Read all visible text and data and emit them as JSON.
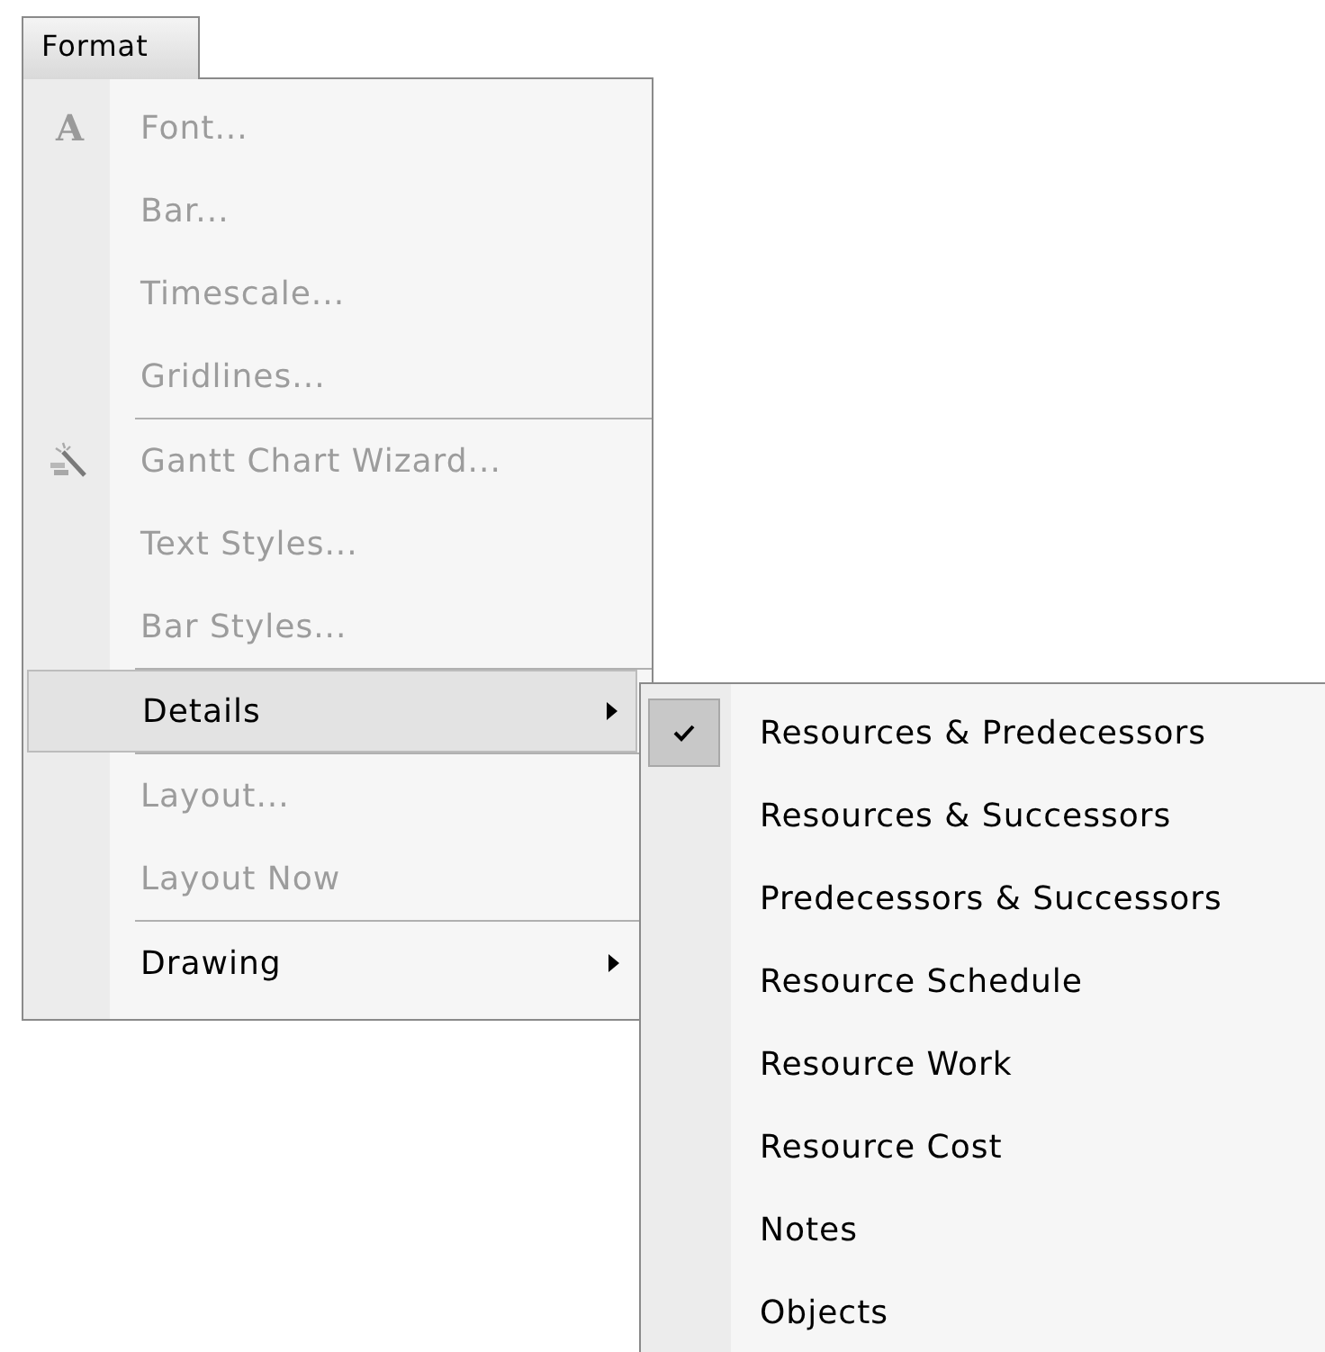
{
  "menu_title": "Format",
  "menu_items": [
    {
      "label": "Font...",
      "disabled": true,
      "selected": false,
      "submenu": false,
      "kind": "glyph",
      "icon_text": "A",
      "separator_before": false
    },
    {
      "label": "Bar...",
      "disabled": true,
      "selected": false,
      "submenu": false,
      "separator_before": false
    },
    {
      "label": "Timescale...",
      "disabled": true,
      "selected": false,
      "submenu": false,
      "separator_before": false
    },
    {
      "label": "Gridlines...",
      "disabled": true,
      "selected": false,
      "submenu": false,
      "separator_before": false
    },
    {
      "label": "Gantt Chart Wizard...",
      "disabled": true,
      "selected": false,
      "submenu": false,
      "kind": "wand",
      "separator_before": true
    },
    {
      "label": "Text Styles...",
      "disabled": true,
      "selected": false,
      "submenu": false,
      "separator_before": false
    },
    {
      "label": "Bar Styles...",
      "disabled": true,
      "selected": false,
      "submenu": false,
      "separator_before": false
    },
    {
      "label": "Details",
      "disabled": false,
      "selected": true,
      "submenu": true,
      "separator_before": true
    },
    {
      "label": "Layout...",
      "disabled": true,
      "selected": false,
      "submenu": false,
      "separator_before": true
    },
    {
      "label": "Layout Now",
      "disabled": true,
      "selected": false,
      "submenu": false,
      "separator_before": false
    },
    {
      "label": "Drawing",
      "disabled": false,
      "selected": false,
      "submenu": true,
      "separator_before": true
    }
  ],
  "submenu_items": [
    {
      "label": "Resources & Predecessors",
      "checked": true
    },
    {
      "label": "Resources & Successors",
      "checked": false
    },
    {
      "label": "Predecessors & Successors",
      "checked": false
    },
    {
      "label": "Resource Schedule",
      "checked": false
    },
    {
      "label": "Resource Work",
      "checked": false
    },
    {
      "label": "Resource Cost",
      "checked": false
    },
    {
      "label": "Notes",
      "checked": false
    },
    {
      "label": "Objects",
      "checked": false
    }
  ]
}
